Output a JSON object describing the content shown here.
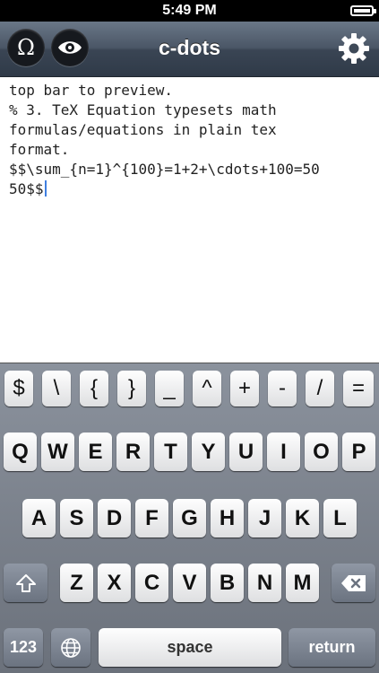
{
  "status": {
    "time": "5:49 PM"
  },
  "nav": {
    "title": "c-dots",
    "omega_glyph": "Ω"
  },
  "editor": {
    "lines": [
      "top bar to preview.",
      "% 3. TeX Equation typesets math",
      "formulas/equations in plain tex",
      "format.",
      "$$\\sum_{n=1}^{100}=1+2+\\cdots+100=50",
      "50$$"
    ]
  },
  "keyboard": {
    "symbol_row": [
      "$",
      "\\",
      "{",
      "}",
      "_",
      "^",
      "+",
      "-",
      "/",
      "="
    ],
    "row1": [
      "Q",
      "W",
      "E",
      "R",
      "T",
      "Y",
      "U",
      "I",
      "O",
      "P"
    ],
    "row2": [
      "A",
      "S",
      "D",
      "F",
      "G",
      "H",
      "J",
      "K",
      "L"
    ],
    "row3": [
      "Z",
      "X",
      "C",
      "V",
      "B",
      "N",
      "M"
    ],
    "numbers_label": "123",
    "space_label": "space",
    "return_label": "return"
  }
}
